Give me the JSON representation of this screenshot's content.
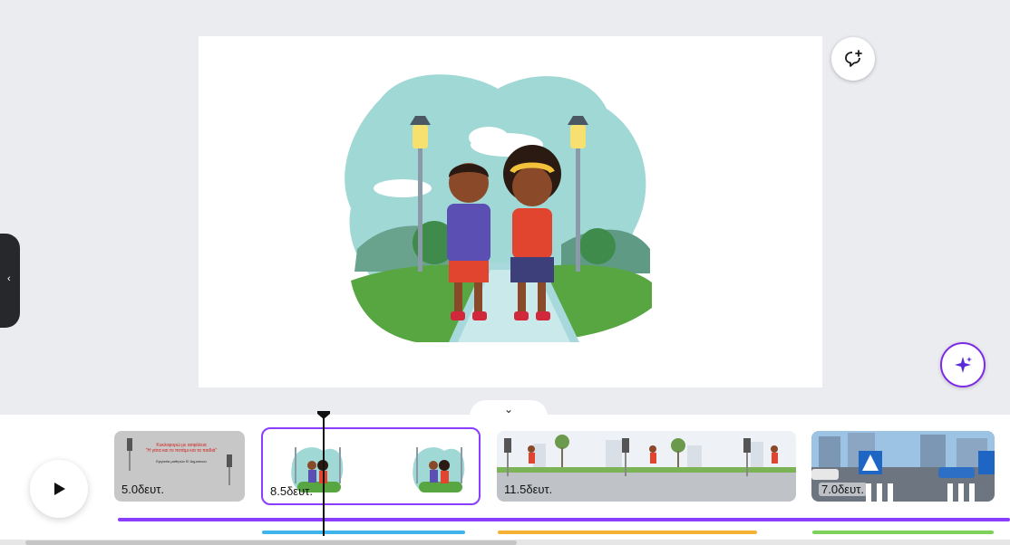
{
  "editor": {
    "side_panel_toggle_icon": "chevron-left-icon",
    "collapse_timeline_icon": "chevron-down-icon",
    "add_comment_icon": "comment-plus-icon",
    "magic_icon": "sparkle-icon",
    "play_icon": "play-icon"
  },
  "timeline": {
    "clips": [
      {
        "duration": "5.0δευτ.",
        "title_line1": "Κυκλοφορώ με ασφάλεια",
        "title_line2": "\"Η γάτα και το ποτάμι και τα παιδιά\"",
        "subtitle": "Εργασία μαθητών Β' Δημοτικού"
      },
      {
        "duration": "8.5δευτ."
      },
      {
        "duration": "11.5δευτ."
      },
      {
        "duration": "7.0δευτ."
      }
    ],
    "selected_clip_index": 1
  },
  "colors": {
    "accent": "#8b3dff",
    "audio_track": "#8b3dff",
    "track_blue": "#3fb4ea",
    "track_orange": "#f5b133",
    "track_green": "#7ed15b"
  }
}
